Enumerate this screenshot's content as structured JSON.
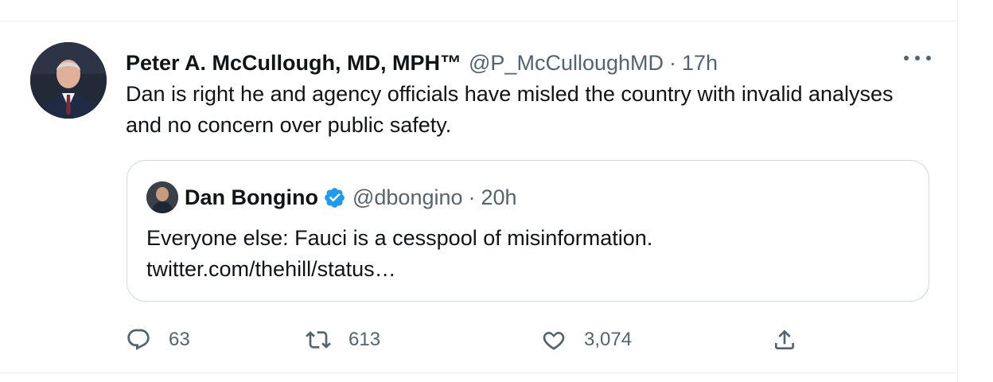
{
  "tweet": {
    "author_name": "Peter A. McCullough, MD, MPH™",
    "author_handle": "@P_McCulloughMD",
    "separator": "·",
    "time": "17h",
    "text": "Dan is right he and agency officials have misled the country with invalid analyses and no concern over public safety.",
    "quoted": {
      "author_name": "Dan Bongino",
      "author_handle": "@dbongino",
      "separator": "·",
      "time": "20h",
      "verified": true,
      "text_line1": "Everyone else: Fauci is a cesspool of misinformation.",
      "text_line2": "twitter.com/thehill/status…"
    },
    "actions": {
      "replies": "63",
      "retweets": "613",
      "likes": "3,074"
    }
  },
  "icons": {
    "reply": "speech-bubble-icon",
    "retweet": "retweet-arrows-icon",
    "like": "heart-icon",
    "share": "share-upload-icon",
    "more": "more-horizontal-icon",
    "verified": "verified-badge-icon"
  },
  "colors": {
    "text": "#0f1419",
    "secondary": "#536471",
    "verified": "#1d9bf0",
    "border": "#cfd9de"
  }
}
